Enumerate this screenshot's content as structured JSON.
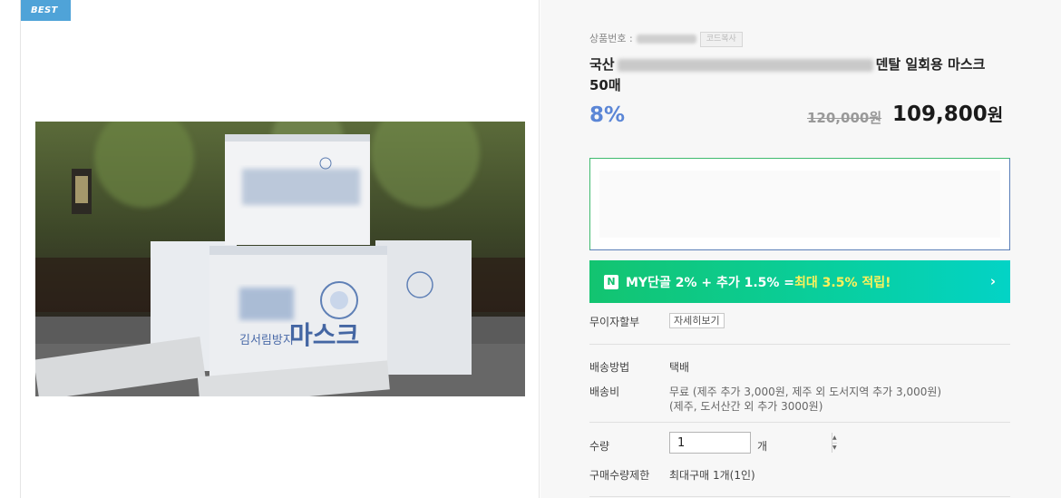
{
  "badge": "BEST",
  "product": {
    "code_label": "상품번호 :",
    "copy_label": "코드복사",
    "title_prefix": "국산",
    "title_suffix": "덴탈 일회용 마스크 50매",
    "discount": "8%",
    "original_price": "120,000원",
    "sale_price": "109,800",
    "sale_unit": "원"
  },
  "photo": {
    "box_text": "김서림방지",
    "box_brand": "마스크"
  },
  "banner": {
    "icon": "naver-n-icon",
    "prefix": "MY단골 2% + 추가 1.5% = ",
    "highlight": "최대 3.5% 적립!",
    "colors": {
      "start": "#13c470",
      "end": "#03d3c6"
    }
  },
  "installment": {
    "label": "무이자할부",
    "button": "자세히보기"
  },
  "shipping": {
    "method_label": "배송방법",
    "method_value": "택배",
    "fee_label": "배송비",
    "fee_line1": "무료 (제주 추가 3,000원, 제주 외 도서지역 추가 3,000원)",
    "fee_line2": "(제주, 도서산간 외 추가 3000원)"
  },
  "quantity": {
    "label": "수량",
    "value": "1",
    "unit": "개"
  },
  "limit": {
    "label": "구매수량제한",
    "value": "최대구매 1개(1인)"
  }
}
